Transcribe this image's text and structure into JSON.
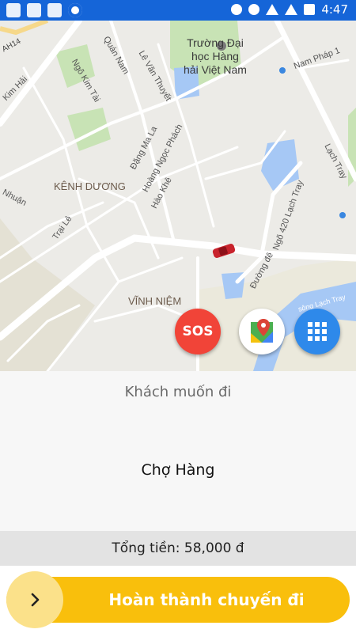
{
  "status_bar": {
    "time": "4:47"
  },
  "map": {
    "labels": {
      "ah14": "AH14",
      "quan_nam": "Quán Nam",
      "le_van_thuyet": "Lê Văn Thuyết",
      "ngo_kim_tai": "Ngõ Kim Tài",
      "kim_hai": "Kim Hải",
      "dang_ma_la": "Đặng Ma La",
      "hoang_ngoc_phach": "Hoàng Ngọc Phách",
      "kenh_duong": "KÊNH DƯƠNG",
      "hao_khe": "Hào Khê",
      "nhuan": "Nhuận",
      "trai_le": "Trại Lẻ",
      "ngo_420": "Ngõ 420 Lạch Tray",
      "lach_tray_road": "Lạch Tray",
      "nam_phap": "Nam Pháp 1",
      "duong_de": "Đường đê",
      "vinh_niem": "VĨNH NIỆM",
      "song_lach_tray": "sông Lạch Tray",
      "uni_line1": "Trường Đại",
      "uni_line2": "học Hàng",
      "uni_line3": "hải Việt Nam"
    }
  },
  "fab": {
    "sos_label": "SOS"
  },
  "trip": {
    "header": "Khách muốn đi",
    "destination": "Chợ Hàng",
    "total": "Tổng tiền: 58,000 đ"
  },
  "action": {
    "complete_label": "Hoàn thành chuyến đi"
  },
  "colors": {
    "status_bar": "#1565d8",
    "sos": "#f14438",
    "grid_button": "#2e89ea",
    "cta": "#f9bf0c"
  }
}
